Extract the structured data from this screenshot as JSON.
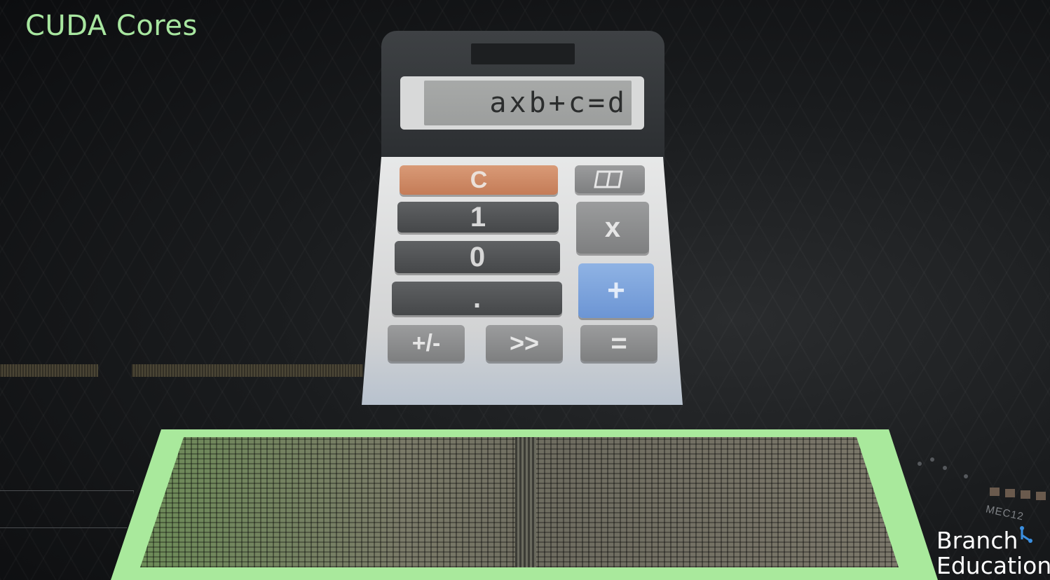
{
  "title": "CUDA Cores",
  "calculator": {
    "display": "axb+c=d",
    "keys": {
      "clear": "C",
      "one": "1",
      "zero": "0",
      "dot": ".",
      "multiply": "x",
      "plus": "+",
      "sign": "+/-",
      "shift": ">>",
      "equals": "="
    }
  },
  "chip_label": "MEC12",
  "brand": {
    "line1": "Branch",
    "line2": "Education"
  },
  "colors": {
    "title": "#a8e6a0",
    "chip_border": "#a9e99c",
    "clear_key": "#c47c57",
    "plus_key": "#6c95d4"
  }
}
